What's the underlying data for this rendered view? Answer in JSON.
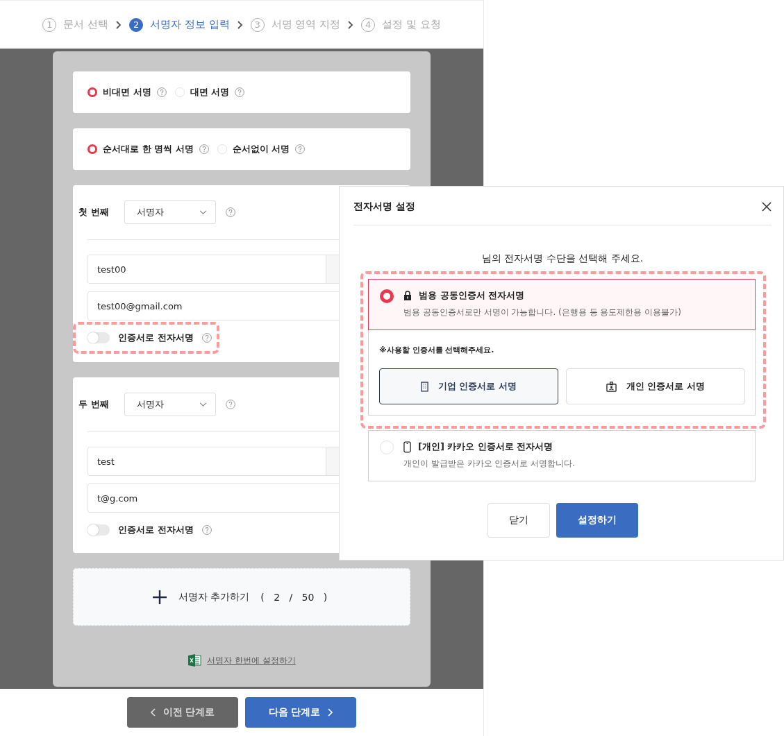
{
  "steps": [
    {
      "number": "1",
      "label": "문서 선택",
      "selected": false
    },
    {
      "number": "2",
      "label": "서명자 정보 입력",
      "selected": true
    },
    {
      "number": "3",
      "label": "서명 영역 지정",
      "selected": false
    },
    {
      "number": "4",
      "label": "설정 및 요청",
      "selected": false
    }
  ],
  "sign_mode": [
    {
      "label": "비대면 서명",
      "selected": true
    },
    {
      "label": "대면 서명",
      "selected": false
    }
  ],
  "sign_order": [
    {
      "label": "순서대로 한 명씩 서명",
      "selected": true
    },
    {
      "label": "순서없이 서명",
      "selected": false
    }
  ],
  "signers": [
    {
      "order_label": "첫 번째",
      "role": "서명자",
      "name": "test00",
      "email": "test00@gmail.com",
      "cert_toggle": {
        "label": "인증서로 전자서명",
        "on": false,
        "annotated": true
      }
    },
    {
      "order_label": "두 번째",
      "role": "서명자",
      "name": "test",
      "email": "t@g.com",
      "cert_toggle": {
        "label": "인증서로 전자서명",
        "on": false
      }
    }
  ],
  "add_signer": {
    "label": "서명자 추가하기",
    "count": "(   2   /   50   )"
  },
  "bulk_link": "서명자 한번에 설정하기",
  "nav": {
    "prev": "이전 단계로",
    "next": "다음 단계로"
  },
  "modal": {
    "title": "전자서명 설정",
    "prompt": "님의 전자서명 수단을 선택해 주세요.",
    "methods": [
      {
        "kind": "certificate",
        "title": "범용 공동인증서 전자서명",
        "description": "범용 공동인증서로만 서명이 가능합니다. (은행용 등 용도제한용 이용불가)",
        "selected": true,
        "annotated": true,
        "note": "※사용할 인증서를 선택해주세요.",
        "cert_buttons": [
          {
            "kind": "corporate",
            "label": "기업 인증서로 서명",
            "selected": true
          },
          {
            "kind": "personal",
            "label": "개인 인증서로 서명",
            "selected": false
          }
        ]
      },
      {
        "kind": "kakao",
        "title": "[개인] 카카오 인증서로 전자서명",
        "description": "개인이 발급받은 카카오 인증서로 서명합니다.",
        "selected": false
      }
    ],
    "buttons": [
      {
        "kind": "secondary",
        "label": "닫기"
      },
      {
        "kind": "primary",
        "label": "설정하기"
      }
    ]
  }
}
